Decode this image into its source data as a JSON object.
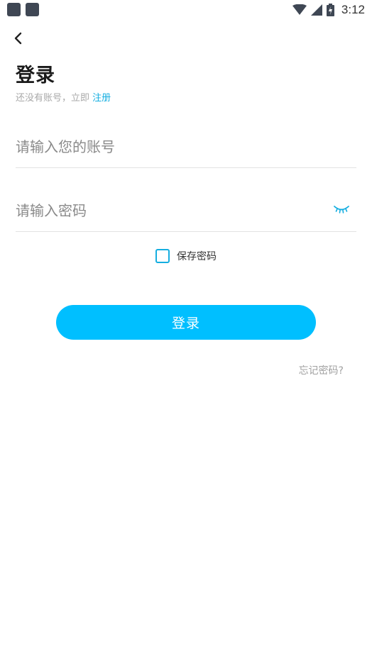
{
  "status_bar": {
    "time": "3:12",
    "notification_icons": [
      "app-notification-icon",
      "app-notification-icon"
    ],
    "icons": [
      "wifi-icon",
      "signal-icon",
      "battery-icon"
    ]
  },
  "nav": {
    "back_icon": "chevron-left-icon"
  },
  "header": {
    "title": "登录",
    "hint_prefix": "还没有账号，立即",
    "register_link": "注册"
  },
  "form": {
    "account_placeholder": "请输入您的账号",
    "account_value": "",
    "password_placeholder": "请输入密码",
    "password_value": "",
    "password_toggle_icon": "eye-closed-icon",
    "remember_label": "保存密码",
    "remember_checked": false,
    "login_button": "登录",
    "forgot_link": "忘记密码?"
  },
  "colors": {
    "accent": "#00bfff",
    "link": "#15aee0",
    "placeholder": "#8a8a8a",
    "hint": "#a9a9a9"
  }
}
